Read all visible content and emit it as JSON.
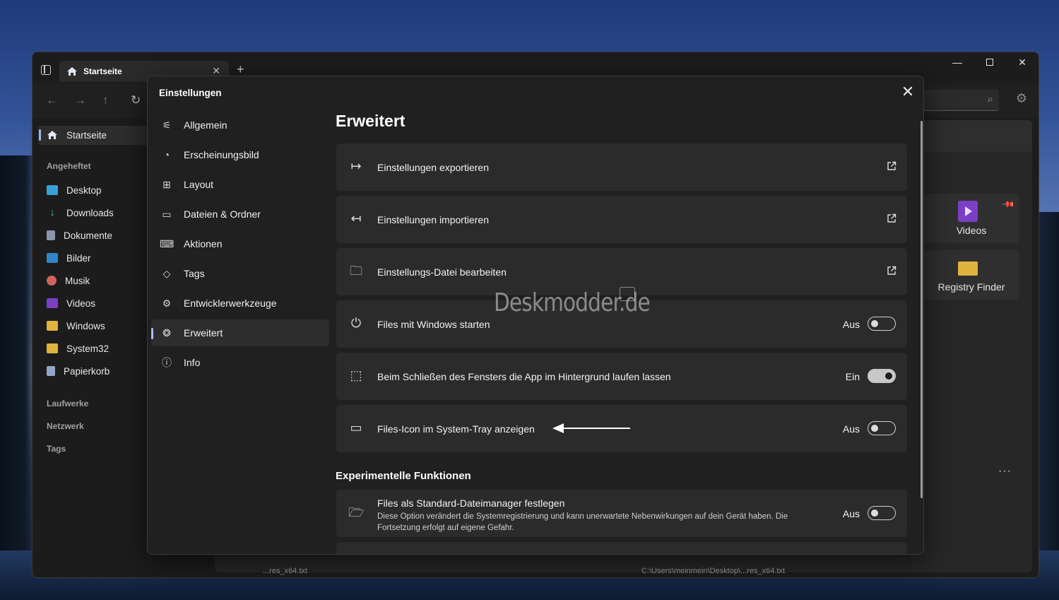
{
  "window": {
    "tab_label": "Startseite",
    "tab_close": "✕",
    "new_tab": "+",
    "minimize": "—",
    "close": "✕"
  },
  "nav": {
    "back": "←",
    "forward": "→",
    "up": "↑",
    "refresh": "↻",
    "search_icon": "⌕",
    "settings_icon": "⚙"
  },
  "file_sidebar": {
    "home": "Startseite",
    "pinned_heading": "Angeheftet",
    "pinned": [
      "Desktop",
      "Downloads",
      "Dokumente",
      "Bilder",
      "Musik",
      "Videos",
      "Windows",
      "System32",
      "Papierkorb"
    ],
    "drives_heading": "Laufwerke",
    "network_heading": "Netzwerk",
    "tags_heading": "Tags"
  },
  "content": {
    "cards": [
      {
        "label": "Videos",
        "icon": "video-folder-icon"
      },
      {
        "label": "Registry Finder",
        "icon": "folder-icon"
      }
    ],
    "more": "···",
    "status_file": "...res_x64.txt",
    "status_path": "C:\\Users\\meinmein\\Desktop\\...res_x64.txt"
  },
  "settings": {
    "title": "Einstellungen",
    "close": "✕",
    "nav": [
      {
        "label": "Allgemein",
        "icon": "sliders-icon"
      },
      {
        "label": "Erscheinungsbild",
        "icon": "palette-icon"
      },
      {
        "label": "Layout",
        "icon": "grid-icon"
      },
      {
        "label": "Dateien & Ordner",
        "icon": "folder-icon"
      },
      {
        "label": "Aktionen",
        "icon": "keyboard-icon"
      },
      {
        "label": "Tags",
        "icon": "tag-icon"
      },
      {
        "label": "Entwicklerwerkzeuge",
        "icon": "developer-icon"
      },
      {
        "label": "Erweitert",
        "icon": "gauge-icon"
      },
      {
        "label": "Info",
        "icon": "info-icon"
      }
    ],
    "active_nav": "Erweitert",
    "heading": "Erweitert",
    "rows": [
      {
        "label": "Einstellungen exportieren",
        "icon": "export-icon",
        "kind": "link"
      },
      {
        "label": "Einstellungen importieren",
        "icon": "import-icon",
        "kind": "link"
      },
      {
        "label": "Einstellungs-Datei bearbeiten",
        "icon": "folder-edit-icon",
        "kind": "link"
      },
      {
        "label": "Files mit Windows starten",
        "icon": "power-icon",
        "kind": "toggle",
        "state": "Aus",
        "on": false
      },
      {
        "label": "Beim Schließen des Fensters die App im Hintergrund laufen lassen",
        "icon": "background-icon",
        "kind": "toggle",
        "state": "Ein",
        "on": true
      },
      {
        "label": "Files-Icon im System-Tray anzeigen",
        "icon": "tray-icon",
        "kind": "toggle",
        "state": "Aus",
        "on": false
      }
    ],
    "experimental_heading": "Experimentelle Funktionen",
    "experimental_rows": [
      {
        "label": "Files als Standard-Dateimanager festlegen",
        "description": "Diese Option verändert die Systemregistrierung und kann unerwartete Nebenwirkungen auf dein Gerät haben. Die Fortsetzung erfolgt auf eigene Gefahr.",
        "icon": "folder-open-icon",
        "state": "Aus",
        "on": false
      }
    ]
  },
  "watermark": "Deskmodder.de",
  "colors": {
    "dialog_bg": "#202020",
    "row_bg": "#2b2b2b",
    "accent": "#a6c0f2"
  }
}
